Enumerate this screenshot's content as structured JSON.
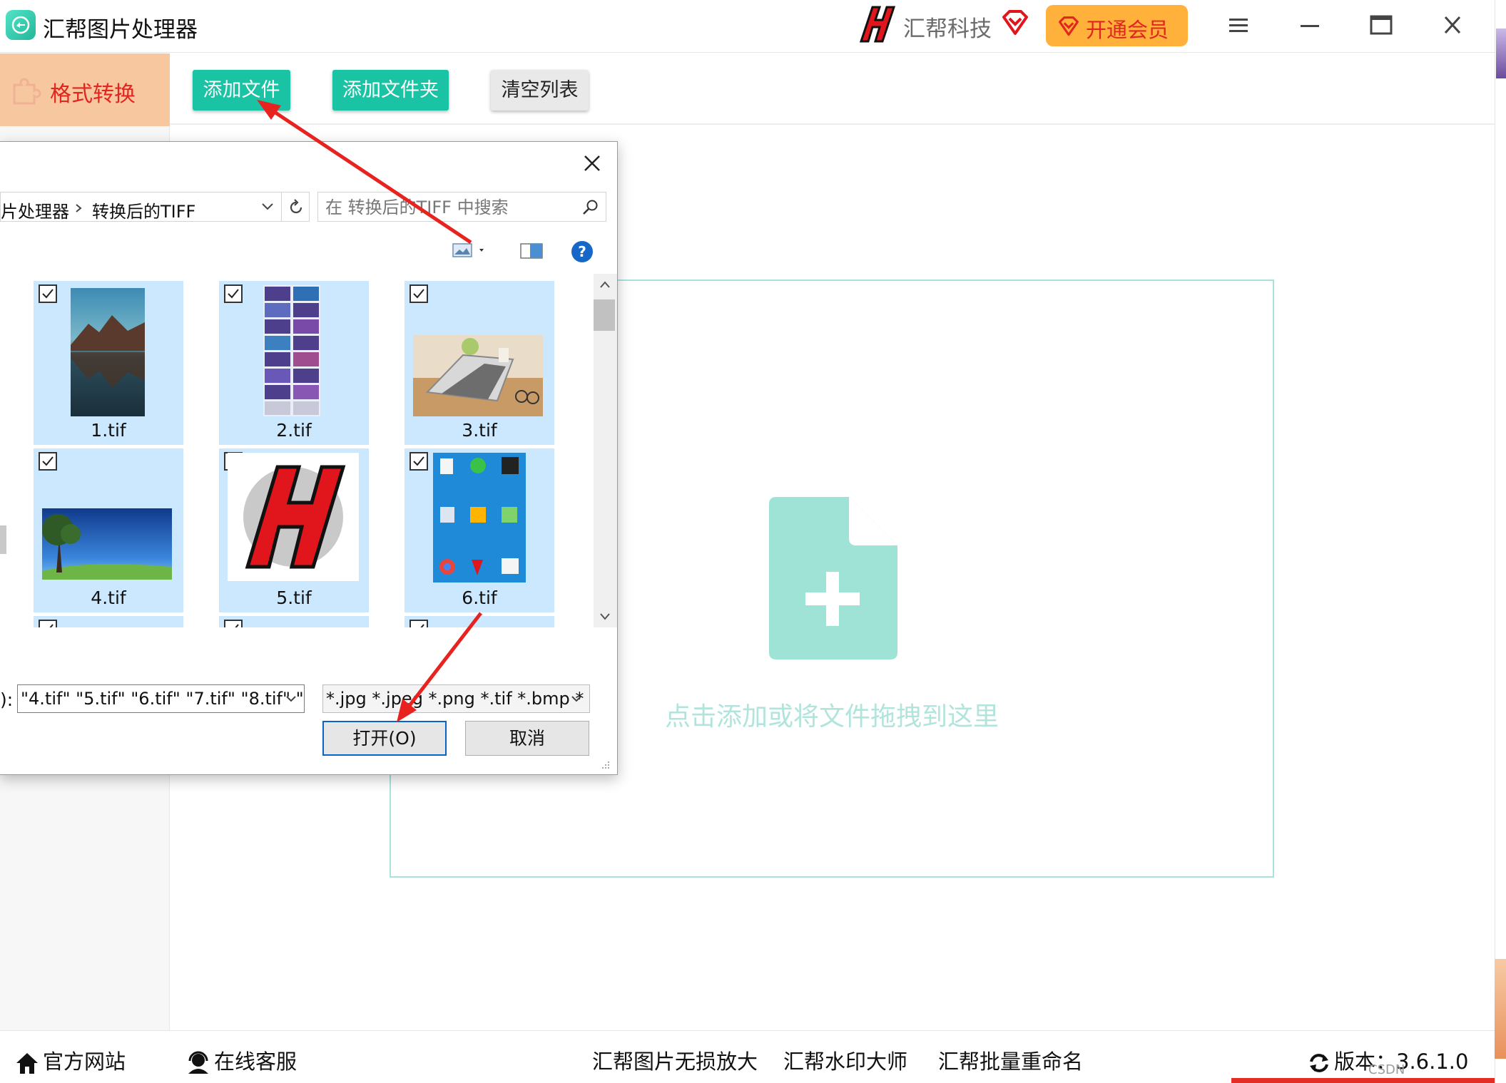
{
  "app": {
    "title": "汇帮图片处理器",
    "brand": "汇帮科技",
    "vip_label": "开通会员"
  },
  "sidebar": {
    "active_item": "格式转换"
  },
  "toolbar": {
    "add_file": "添加文件",
    "add_folder": "添加文件夹",
    "clear_list": "清空列表"
  },
  "dropzone": {
    "hint": "点击添加或将文件拖拽到这里"
  },
  "dialog": {
    "breadcrumb": [
      "片处理器",
      "转换后的TIFF"
    ],
    "search_placeholder": "在 转换后的TIFF 中搜索",
    "files": [
      {
        "name": "1.tif",
        "checked": true
      },
      {
        "name": "2.tif",
        "checked": true
      },
      {
        "name": "3.tif",
        "checked": true
      },
      {
        "name": "4.tif",
        "checked": true
      },
      {
        "name": "5.tif",
        "checked": true
      },
      {
        "name": "6.tif",
        "checked": true
      },
      {
        "name": "",
        "checked": true
      },
      {
        "name": "",
        "checked": true
      },
      {
        "name": "",
        "checked": true
      }
    ],
    "filename_label_tail": "):",
    "filename_value": "\"4.tif\" \"5.tif\" \"6.tif\" \"7.tif\" \"8.tif\" \"",
    "filetype_value": "*.jpg *.jpeg *.png *.tif *.bmp *",
    "open_label": "打开(O)",
    "cancel_label": "取消"
  },
  "statusbar": {
    "website": "官方网站",
    "support": "在线客服",
    "links": [
      "汇帮图片无损放大",
      "汇帮水印大师",
      "汇帮批量重命名"
    ],
    "version": "版本：3.6.1.0",
    "watermark": "CSDN @keji_fenxiang"
  },
  "colors": {
    "accent": "#19c3a3",
    "vip": "#ffb13b",
    "active_tab": "#f7c7a0",
    "annotation_arrow": "#e8231f"
  }
}
